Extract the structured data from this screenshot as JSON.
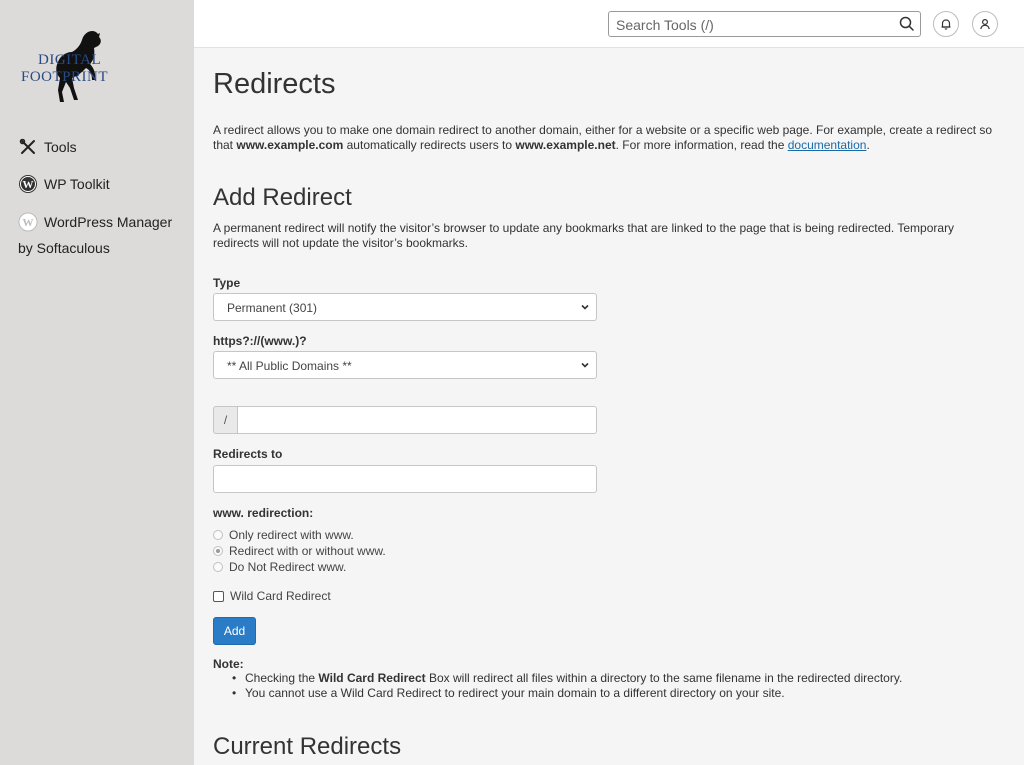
{
  "sidebar": {
    "logo": {
      "line1": "DIGITAL",
      "line2": "FOOTPRINT"
    },
    "items": [
      {
        "label": "Tools",
        "icon": "tools-icon"
      },
      {
        "label": "WP Toolkit",
        "icon": "wordpress-icon"
      },
      {
        "label": "WordPress Manager",
        "label2": "by Softaculous",
        "icon": "wordpress-icon"
      }
    ]
  },
  "topbar": {
    "search_placeholder": "Search Tools (/)"
  },
  "main": {
    "title": "Redirects",
    "intro": {
      "p1": "A redirect allows you to make one domain redirect to another domain, either for a website or a specific web page. For example, create a redirect so that ",
      "b1": "www.example.com",
      "p2": " automatically redirects users to ",
      "b2": "www.example.net",
      "p3": ". For more information, read the ",
      "link": "documentation",
      "p4": "."
    },
    "add_section": {
      "title": "Add Redirect",
      "description": "A permanent redirect will notify the visitor’s browser to update any bookmarks that are linked to the page that is being redirected. Temporary redirects will not update the visitor’s bookmarks.",
      "type_label": "Type",
      "type_value": "Permanent (301)",
      "protocol_label": "https?://(www.)?",
      "domain_value": "** All Public Domains **",
      "path_prefix": "/",
      "path_value": "",
      "redirects_to_label": "Redirects to",
      "redirects_to_value": "",
      "www_label": "www. redirection:",
      "www_options": [
        {
          "label": "Only redirect with www.",
          "checked": false
        },
        {
          "label": "Redirect with or without www.",
          "checked": true
        },
        {
          "label": "Do Not Redirect www.",
          "checked": false
        }
      ],
      "wildcard_label": "Wild Card Redirect",
      "wildcard_checked": false,
      "add_button": "Add"
    },
    "note": {
      "title": "Note:",
      "item1_pre": "Checking the ",
      "item1_bold": "Wild Card Redirect",
      "item1_post": " Box will redirect all files within a directory to the same filename in the redirected directory.",
      "item2": "You cannot use a Wild Card Redirect to redirect your main domain to a different directory on your site."
    },
    "current_section": {
      "title": "Current Redirects"
    }
  },
  "colors": {
    "sidebar_bg": "#dcdbd9",
    "page_bg": "#f5f5f5",
    "primary_button": "#2a7cc7",
    "link": "#1b6aa8",
    "logo_text": "#2a4a86"
  }
}
